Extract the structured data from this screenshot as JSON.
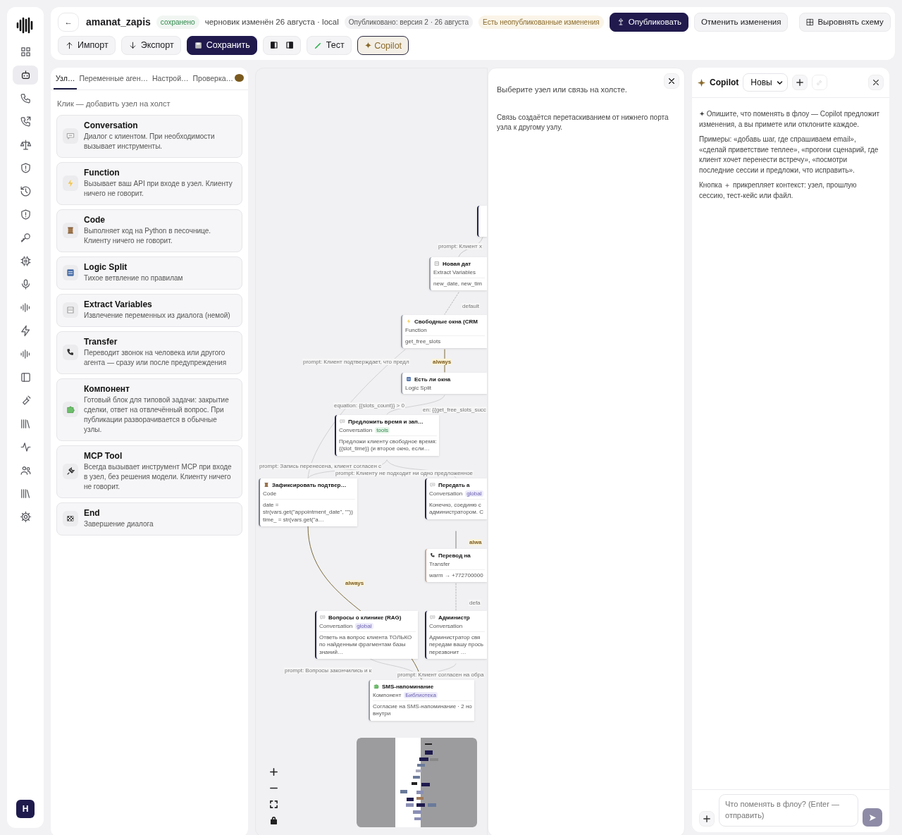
{
  "sidebar": {
    "nav": [
      {
        "kind": "grid",
        "selected": false
      },
      {
        "kind": "robot",
        "selected": true
      },
      {
        "kind": "phone",
        "selected": false
      },
      {
        "kind": "phone-out",
        "selected": false
      },
      {
        "kind": "scales",
        "selected": false
      },
      {
        "kind": "shield",
        "selected": false
      },
      {
        "kind": "history",
        "selected": false
      },
      {
        "kind": "shield",
        "selected": false
      },
      {
        "kind": "key",
        "selected": false
      },
      {
        "kind": "chip",
        "selected": false
      },
      {
        "kind": "mic",
        "selected": false
      },
      {
        "kind": "wave",
        "selected": false
      },
      {
        "kind": "bolt",
        "selected": false
      },
      {
        "kind": "wave",
        "selected": false
      },
      {
        "kind": "panel",
        "selected": false
      },
      {
        "kind": "wrench",
        "selected": false
      },
      {
        "kind": "library",
        "selected": false
      },
      {
        "kind": "pulse",
        "selected": false
      },
      {
        "kind": "people",
        "selected": false
      },
      {
        "kind": "library",
        "selected": false
      },
      {
        "kind": "gear",
        "selected": false
      }
    ],
    "avatar": "H"
  },
  "header": {
    "back": "←",
    "title": "amanat_zapis",
    "saved_badge": "сохранено",
    "draft_info": "черновик изменён 26 августа · local",
    "published_badge": "Опубликовано: версия 2 · 26 августа",
    "unpublished_badge": "Есть неопубликованные изменения",
    "publish_button": "Опубликовать",
    "discard_button": "Отменить изменения",
    "layout_button": "Выровнять схему"
  },
  "toolbar": [
    {
      "kind": "import",
      "label": "Импорт"
    },
    {
      "kind": "export",
      "label": "Экспорт"
    },
    {
      "kind": "save",
      "label": "Сохранить"
    },
    {
      "kind": "panels"
    },
    {
      "kind": "test",
      "label": "Тест"
    },
    {
      "kind": "copilot",
      "label": "✦ Copilot"
    }
  ],
  "palette": {
    "tabs": [
      {
        "label": "Узл…",
        "selected": true,
        "alert": false
      },
      {
        "label": "Переменные аген…",
        "selected": false,
        "alert": false
      },
      {
        "label": "Настрой…",
        "selected": false,
        "alert": false
      },
      {
        "label": "Проверка…",
        "selected": false,
        "alert": true
      }
    ],
    "hint": "Клик — добавить узел на холст",
    "items": [
      {
        "kind": "conversation",
        "title": "Conversation",
        "description": "Диалог с клиентом. При необходимости вызывает инструменты."
      },
      {
        "kind": "function",
        "title": "Function",
        "description": "Вызывает ваш API при входе в узел. Клиенту ничего не говорит."
      },
      {
        "kind": "code",
        "title": "Code",
        "description": "Выполняет код на Python в песочнице. Клиенту ничего не говорит."
      },
      {
        "kind": "split",
        "title": "Logic Split",
        "description": "Тихое ветвление по правилам"
      },
      {
        "kind": "extract",
        "title": "Extract Variables",
        "description": "Извлечение переменных из диалога (немой)"
      },
      {
        "kind": "transfer",
        "title": "Transfer",
        "description": "Переводит звонок на человека или другого агента — сразу или после предупреждения"
      },
      {
        "kind": "component",
        "title": "Компонент",
        "description": "Готовый блок для типовой задачи: закрытие сделки, ответ на отвлечённый вопрос. При публикации разворачивается в обычные узлы."
      },
      {
        "kind": "mcp",
        "title": "MCP Tool",
        "description": "Всегда вызывает инструмент MCP при входе в узел, без решения модели. Клиенту ничего не говорит."
      },
      {
        "kind": "end",
        "title": "End",
        "description": "Завершение диалога"
      }
    ]
  },
  "canvas": {
    "nodes": [
      {
        "kind": "extract",
        "title": "Новая дат",
        "type": "Extract Variables",
        "body": "new_date, new_tim"
      },
      {
        "kind": "function",
        "title": "Свободные окна (CRM",
        "type": "Function",
        "body": "get_free_slots"
      },
      {
        "kind": "split",
        "title": "Есть ли окна",
        "type": "Logic Split"
      },
      {
        "kind": "conversation",
        "title": "Предложить время и зап…",
        "type": "Conversation",
        "tag": "tools",
        "body": "Предложи клиенту свободное время: {{slot_time}} (и второе окно, если…"
      },
      {
        "kind": "code",
        "title": "Зафиксировать подтвер…",
        "type": "Code",
        "body": "date = str(vars.get(\"appointment_date\", \"\")) time_ = str(vars.get(\"a…"
      },
      {
        "kind": "conversation",
        "title": "Передать а",
        "type": "Conversation",
        "tag": "global",
        "body": "Конечно, соединю с администратором. С"
      },
      {
        "kind": "transfer",
        "title": "Перевод на",
        "type": "Transfer",
        "body": "warm → +772700000"
      },
      {
        "kind": "conversation",
        "title": "Вопросы о клинике (RAG)",
        "type": "Conversation",
        "tag": "global",
        "body": "Ответь на вопрос клиента ТОЛЬКО по найденным фрагментам базы знаний…"
      },
      {
        "kind": "conversation",
        "title": "Администр",
        "type": "Conversation",
        "body": "Администратор свя передам вашу прось перезвонит …"
      },
      {
        "kind": "component",
        "title": "SMS-напоминание",
        "type": "Компонент",
        "tag": "Библиотека",
        "body": "Согласие на SMS-напоминание · 2 но внутри"
      }
    ],
    "edge_labels": [
      "prompt: Клиент х",
      "default",
      "always",
      "prompt: Клиент подтверждает, что предл",
      "equation: {{slots_count}} > 0",
      "en: {{get_free_slots_succ",
      "prompt: Запись перенесена, клиент согласен с",
      "prompt: Клиенту не подходит ни одно предложенное",
      "alwa",
      "defa",
      "always",
      "prompt: Вопросы закончились и к",
      "prompt: Клиент согласен на обра"
    ]
  },
  "inspector": {
    "hint": "Выберите узел или связь на холсте.",
    "description": "Связь создаётся перетаскиванием от нижнего порта узла к другому узлу."
  },
  "copilot": {
    "title": "Copilot",
    "mode": "Новы",
    "messages": [
      "✦ Опишите, что поменять в флоу — Copilot предложит изменения, а вы примете или отклоните каждое.",
      "Примеры: «добавь шаг, где спрашиваем email», «сделай приветствие теплее», «прогони сценарий, где клиент хочет перенести встречу», «посмотри последние сессии и предложи, что исправить».",
      "Кнопка ＋ прикрепляет контекст: узел, прошлую сессию, тест-кейс или файл."
    ],
    "placeholder": "Что поменять в флоу? (Enter — отправить)"
  }
}
